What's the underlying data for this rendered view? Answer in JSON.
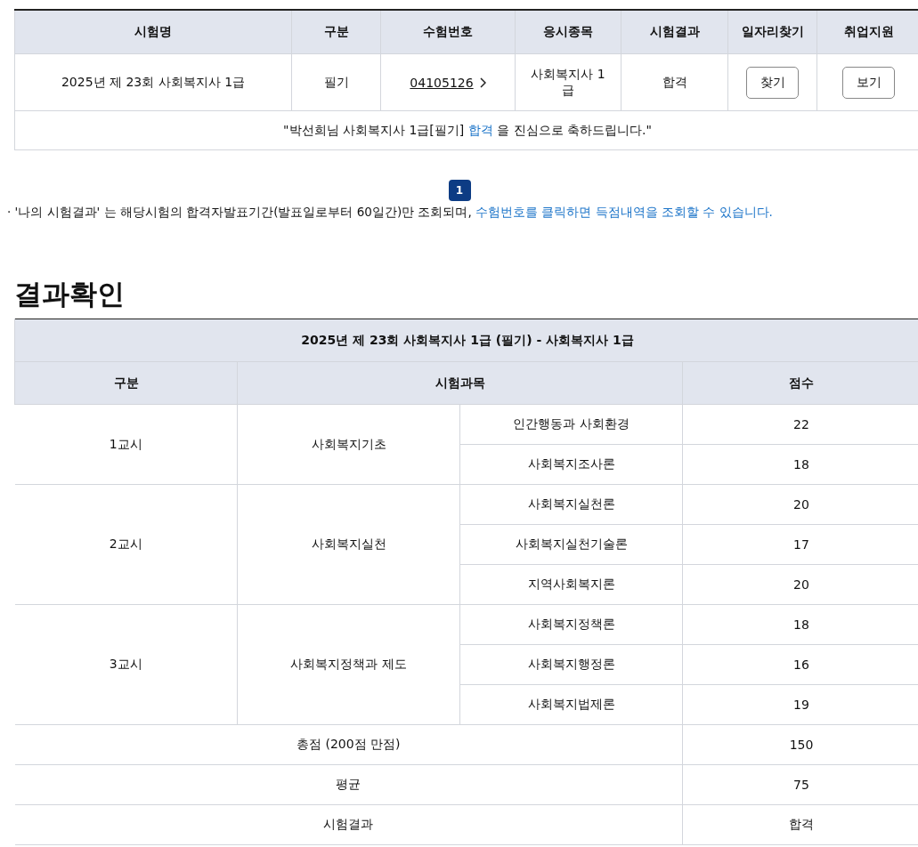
{
  "exam_table": {
    "columns": [
      "시험명",
      "구분",
      "수험번호",
      "응시종목",
      "시험결과",
      "일자리찾기",
      "취업지원"
    ],
    "row": {
      "exam_name": "2025년 제 23회 사회복지사 1급",
      "type": "필기",
      "exam_number": "04105126",
      "subject": "사회복지사 1급",
      "result": "합격",
      "find_button": "찾기",
      "view_button": "보기"
    },
    "message": {
      "before": "\"박선희님 사회복지사 1급[필기] ",
      "highlight": "합격",
      "after": " 을 진심으로 축하드립니다.\""
    }
  },
  "pagination": [
    {
      "label": "1",
      "selected": true
    }
  ],
  "note": {
    "bullet": "·",
    "text": "'나의 시험결과' 는 해당시험의 합격자발표기간(발표일로부터 60일간)만 조회되며, ",
    "highlight": "수험번호를 클릭하면 득점내역을 조회할 수 있습니다."
  },
  "section_title": "결과확인",
  "score_table": {
    "title": "2025년 제 23회 사회복지사 1급 (필기) - 사회복지사 1급",
    "columns": [
      "구분",
      "시험과목",
      "점수"
    ],
    "groups": [
      {
        "session": "1교시",
        "subject_group": "사회복지기초",
        "items": [
          {
            "subject": "인간행동과 사회환경",
            "score": "22"
          },
          {
            "subject": "사회복지조사론",
            "score": "18"
          }
        ]
      },
      {
        "session": "2교시",
        "subject_group": "사회복지실천",
        "items": [
          {
            "subject": "사회복지실천론",
            "score": "20"
          },
          {
            "subject": "사회복지실천기술론",
            "score": "17"
          },
          {
            "subject": "지역사회복지론",
            "score": "20"
          }
        ]
      },
      {
        "session": "3교시",
        "subject_group": "사회복지정책과 제도",
        "items": [
          {
            "subject": "사회복지정책론",
            "score": "18"
          },
          {
            "subject": "사회복지행정론",
            "score": "16"
          },
          {
            "subject": "사회복지법제론",
            "score": "19"
          }
        ]
      }
    ],
    "summary": [
      {
        "label": "총점 (200점 만점)",
        "value": "150"
      },
      {
        "label": "평균",
        "value": "75"
      },
      {
        "label": "시험결과",
        "value": "합격"
      }
    ]
  }
}
